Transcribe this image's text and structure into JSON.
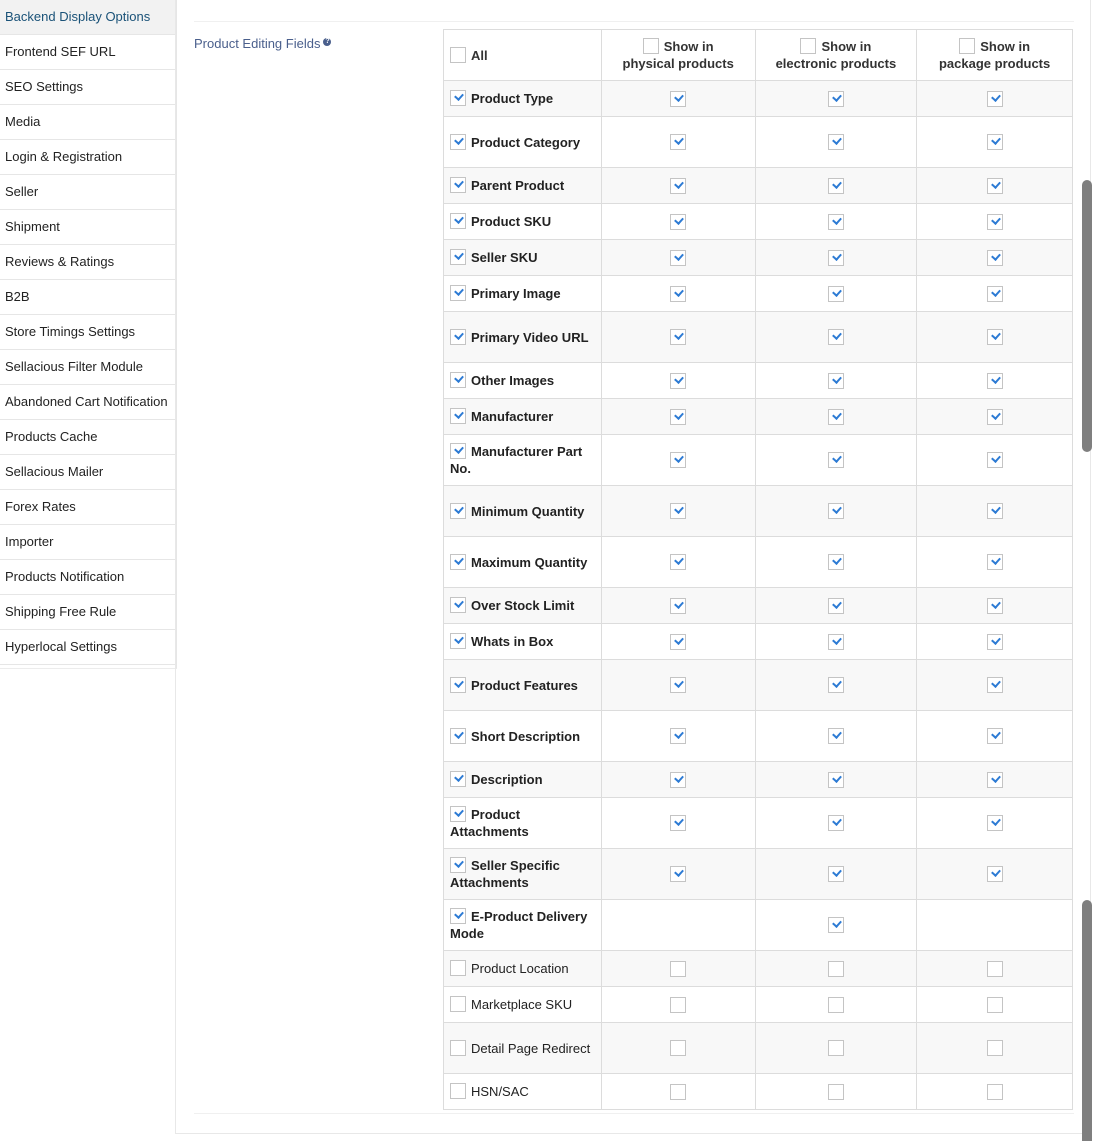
{
  "sidebar": {
    "items": [
      {
        "label": "Backend Display Options",
        "active": true
      },
      {
        "label": "Frontend SEF URL"
      },
      {
        "label": "SEO Settings"
      },
      {
        "label": "Media"
      },
      {
        "label": "Login & Registration"
      },
      {
        "label": "Seller"
      },
      {
        "label": "Shipment"
      },
      {
        "label": "Reviews & Ratings"
      },
      {
        "label": "B2B"
      },
      {
        "label": "Store Timings Settings"
      },
      {
        "label": "Sellacious Filter Module"
      },
      {
        "label": "Abandoned Cart Notification"
      },
      {
        "label": "Products Cache"
      },
      {
        "label": "Sellacious Mailer"
      },
      {
        "label": "Forex Rates"
      },
      {
        "label": "Importer"
      },
      {
        "label": "Products Notification"
      },
      {
        "label": "Shipping Free Rule"
      },
      {
        "label": "Hyperlocal Settings"
      }
    ]
  },
  "field": {
    "label": "Product Editing Fields",
    "help_icon": "question-circle-icon",
    "help_glyph": "?"
  },
  "table": {
    "headers": {
      "all": {
        "label": "All",
        "checked": false
      },
      "physical": {
        "line1": "Show in",
        "line2": "physical products",
        "checked": false
      },
      "electronic": {
        "line1": "Show in",
        "line2": "electronic products",
        "checked": false
      },
      "package": {
        "line1": "Show in",
        "line2": "package products",
        "checked": false
      }
    },
    "rows": [
      {
        "label": "Product Type",
        "enabled": true,
        "physical": true,
        "electronic": true,
        "package": true
      },
      {
        "label": "Product Category",
        "enabled": true,
        "physical": true,
        "electronic": true,
        "package": true
      },
      {
        "label": "Parent Product",
        "enabled": true,
        "physical": true,
        "electronic": true,
        "package": true
      },
      {
        "label": "Product SKU",
        "enabled": true,
        "physical": true,
        "electronic": true,
        "package": true
      },
      {
        "label": "Seller SKU",
        "enabled": true,
        "physical": true,
        "electronic": true,
        "package": true
      },
      {
        "label": "Primary Image",
        "enabled": true,
        "physical": true,
        "electronic": true,
        "package": true
      },
      {
        "label": "Primary Video URL",
        "enabled": true,
        "physical": true,
        "electronic": true,
        "package": true
      },
      {
        "label": "Other Images",
        "enabled": true,
        "physical": true,
        "electronic": true,
        "package": true
      },
      {
        "label": "Manufacturer",
        "enabled": true,
        "physical": true,
        "electronic": true,
        "package": true
      },
      {
        "label": "Manufacturer Part No.",
        "enabled": true,
        "physical": true,
        "electronic": true,
        "package": true
      },
      {
        "label": "Minimum Quantity",
        "enabled": true,
        "physical": true,
        "electronic": true,
        "package": true
      },
      {
        "label": "Maximum Quantity",
        "enabled": true,
        "physical": true,
        "electronic": true,
        "package": true
      },
      {
        "label": "Over Stock Limit",
        "enabled": true,
        "physical": true,
        "electronic": true,
        "package": true
      },
      {
        "label": "Whats in Box",
        "enabled": true,
        "physical": true,
        "electronic": true,
        "package": true
      },
      {
        "label": "Product Features",
        "enabled": true,
        "physical": true,
        "electronic": true,
        "package": true
      },
      {
        "label": "Short Description",
        "enabled": true,
        "physical": true,
        "electronic": true,
        "package": true
      },
      {
        "label": "Description",
        "enabled": true,
        "physical": true,
        "electronic": true,
        "package": true
      },
      {
        "label": "Product Attachments",
        "enabled": true,
        "physical": true,
        "electronic": true,
        "package": true
      },
      {
        "label": "Seller Specific Attachments",
        "enabled": true,
        "physical": true,
        "electronic": true,
        "package": true
      },
      {
        "label": "E-Product Delivery Mode",
        "enabled": true,
        "physical": null,
        "electronic": true,
        "package": null
      },
      {
        "label": "Product Location",
        "enabled": false,
        "physical": false,
        "electronic": false,
        "package": false
      },
      {
        "label": "Marketplace SKU",
        "enabled": false,
        "physical": false,
        "electronic": false,
        "package": false
      },
      {
        "label": "Detail Page Redirect",
        "enabled": false,
        "physical": false,
        "electronic": false,
        "package": false
      },
      {
        "label": "HSN/SAC",
        "enabled": false,
        "physical": false,
        "electronic": false,
        "package": false
      }
    ]
  },
  "colors": {
    "accent_check": "#2d7bd4",
    "label_blue": "#4a5f8c",
    "active_sidebar_text": "#1a5278",
    "scrollbar": "#7f7f7f"
  }
}
